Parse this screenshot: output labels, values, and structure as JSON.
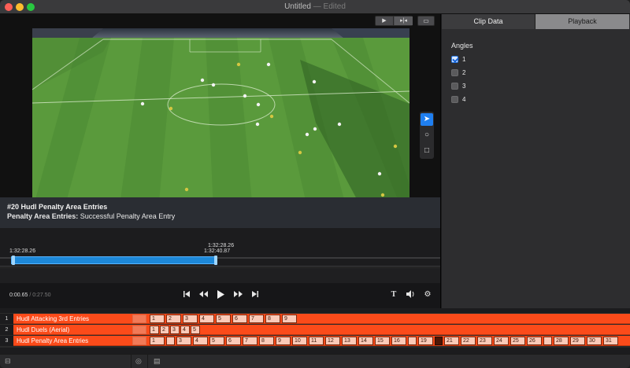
{
  "window": {
    "title": "Untitled",
    "status": "— Edited"
  },
  "viewer": {
    "mode_buttons": [
      {
        "icon": "play-mode-icon",
        "glyph": "▶"
      },
      {
        "icon": "split-mode-icon",
        "glyph": "▸|◂"
      }
    ],
    "screen_button_icon": "presentation-icon",
    "tools": [
      {
        "name": "pointer-tool-icon",
        "glyph": "➤",
        "selected": true
      },
      {
        "name": "circle-tool-icon",
        "glyph": "○",
        "selected": false
      },
      {
        "name": "square-tool-icon",
        "glyph": "□",
        "selected": false
      }
    ]
  },
  "clip": {
    "title": "#20 Hudl Penalty Area Entries",
    "subtitle_label": "Penalty Area Entries:",
    "subtitle_value": "Successful Penalty Area Entry"
  },
  "scrubber": {
    "start_time": "1:32:28.26",
    "end_time_top": "1:32:28.26",
    "end_time_bottom": "1:32:40.87"
  },
  "playback": {
    "current_time": "0:00.65",
    "total_time": "/ 0:27.50"
  },
  "right_panel": {
    "tabs": [
      {
        "label": "Clip Data",
        "active": true
      },
      {
        "label": "Playback",
        "active": false
      }
    ],
    "angles_label": "Angles",
    "angles": [
      {
        "label": "1",
        "checked": true
      },
      {
        "label": "2",
        "checked": false
      },
      {
        "label": "3",
        "checked": false
      },
      {
        "label": "4",
        "checked": false
      }
    ]
  },
  "timeline": {
    "rows": [
      {
        "num": "1",
        "name": "Hudl Attacking 3rd Entries",
        "cells": [
          "1",
          "2",
          "3",
          "4",
          "5",
          "6",
          "7",
          "8",
          "9"
        ]
      },
      {
        "num": "2",
        "name": "Hudl Duels (Aerial)",
        "cells": [
          "1",
          "2",
          "3",
          "4",
          "5"
        ]
      },
      {
        "num": "3",
        "name": "Hudl Penalty Area Entries",
        "cells": [
          "1",
          "",
          "3",
          "4",
          "5",
          "6",
          "7",
          "8",
          "9",
          "10",
          "11",
          "12",
          "13",
          "14",
          "15",
          "16",
          "",
          "19",
          "",
          "21",
          "22",
          "23",
          "24",
          "25",
          "26",
          "",
          "28",
          "29",
          "30",
          "31"
        ]
      }
    ],
    "accent_color": "#fb4b1a"
  }
}
